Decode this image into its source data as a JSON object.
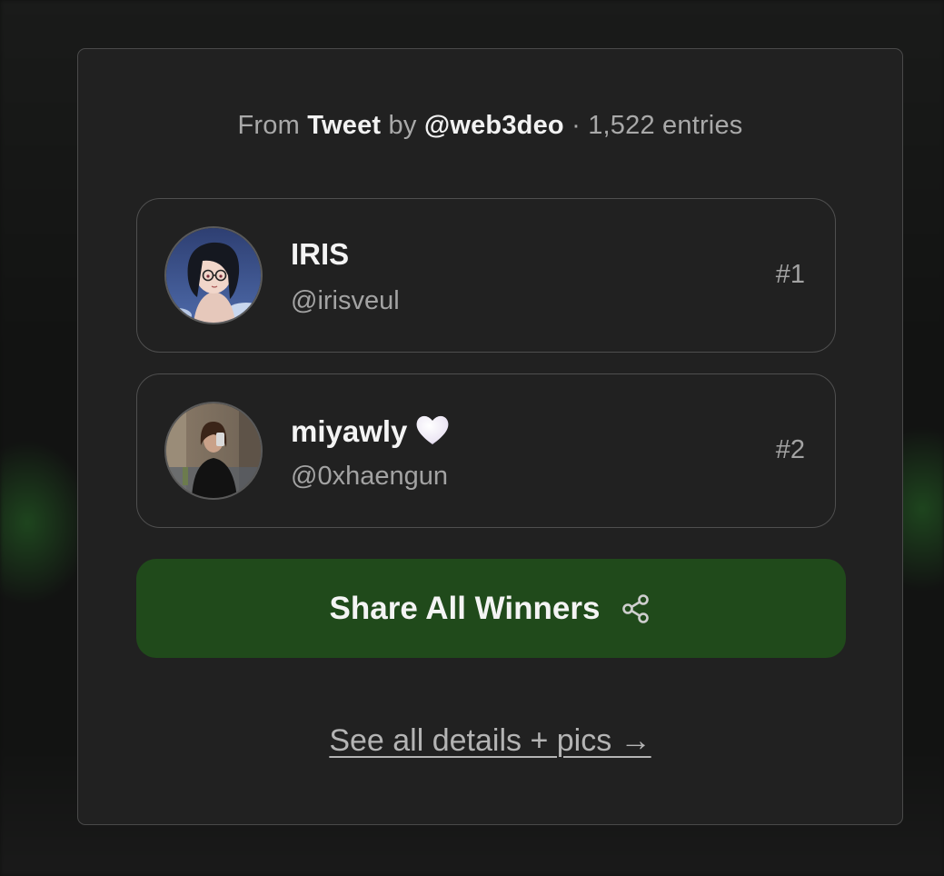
{
  "header": {
    "from_text": "From",
    "source": "Tweet",
    "by_text": "by",
    "author": "@web3deo",
    "separator": "·",
    "entries": "1,522 entries"
  },
  "winners": [
    {
      "name": "IRIS",
      "handle": "@irisveul",
      "rank": "#1",
      "avatar_icon": "anime-avatar-icon"
    },
    {
      "name": "miyawly",
      "name_emoji": "white-heart-icon",
      "handle": "@0xhaengun",
      "rank": "#2",
      "avatar_icon": "selfie-avatar-icon"
    }
  ],
  "actions": {
    "share_label": "Share All Winners",
    "share_icon": "share-icon",
    "details_label": "See all details + pics →"
  },
  "colors": {
    "card_background": "#212121",
    "share_button": "#204a1b",
    "glow_green": "#286e28"
  }
}
